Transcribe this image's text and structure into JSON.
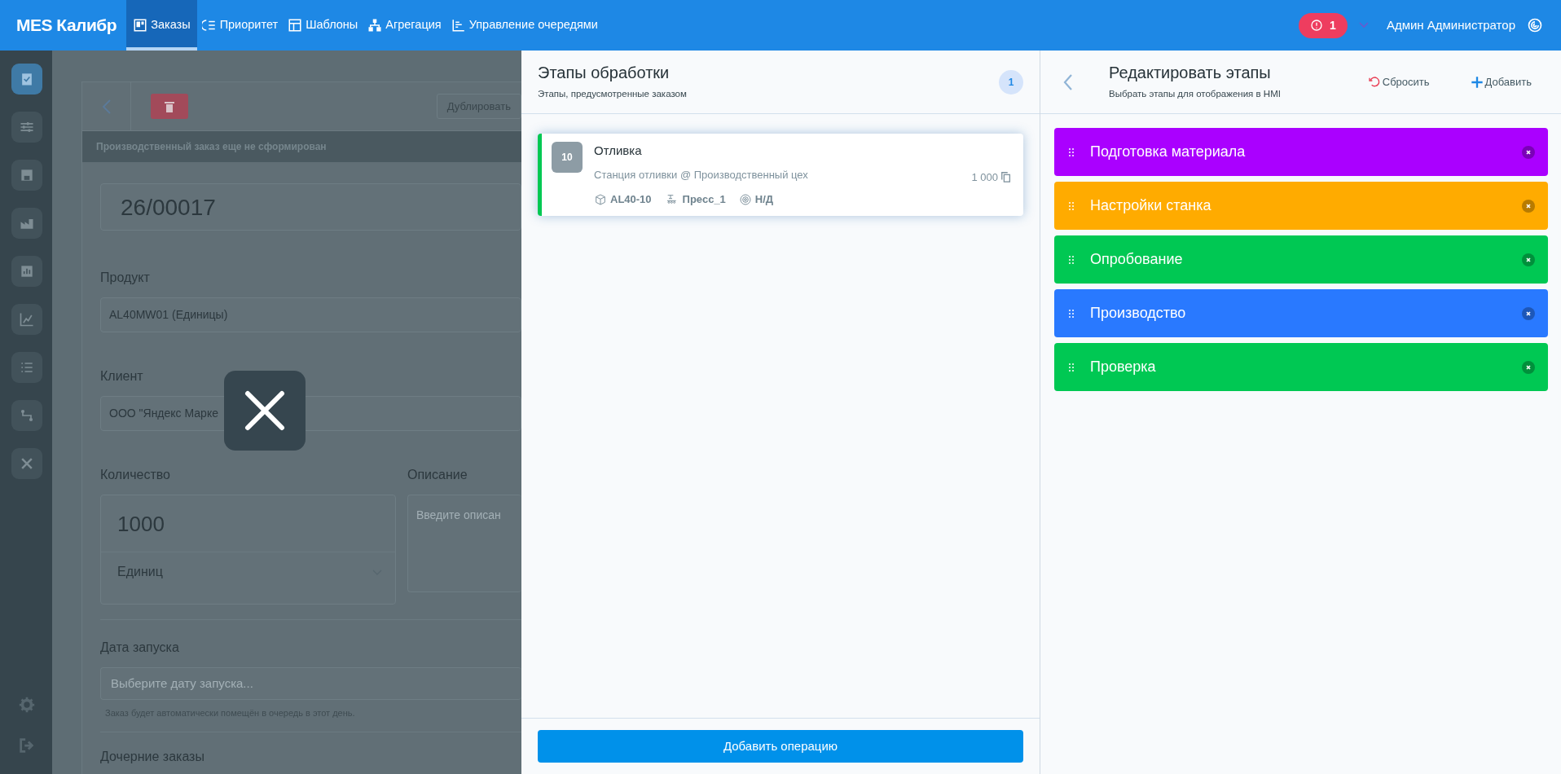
{
  "navbar": {
    "brand": "MES Калибр",
    "items": [
      {
        "label": "Заказы",
        "selected": true
      },
      {
        "label": "Приоритет",
        "selected": false
      },
      {
        "label": "Шаблоны",
        "selected": false
      },
      {
        "label": "Агрегация",
        "selected": false
      },
      {
        "label": "Управление очередями",
        "selected": false
      }
    ],
    "alert_count": "1",
    "user": "Админ Администратор"
  },
  "sidebar": {
    "items": [
      {
        "selected": true
      },
      {
        "selected": false
      },
      {
        "selected": false
      },
      {
        "selected": false
      },
      {
        "selected": false
      },
      {
        "selected": false
      },
      {
        "selected": false
      },
      {
        "selected": false
      },
      {
        "selected": false
      }
    ]
  },
  "order_form": {
    "duplicate_button": "Дублировать",
    "notice": "Производственный заказ еще не сформирован",
    "number": "26/00017",
    "product": {
      "label": "Продукт",
      "value": "AL40MW01 (Единицы)"
    },
    "client": {
      "label": "Клиент",
      "value": "ООО \"Яндекс Марке"
    },
    "quantity": {
      "label": "Количество",
      "value": "1000",
      "unit": "Единиц"
    },
    "description": {
      "label": "Описание",
      "placeholder": "Введите описан"
    },
    "start_date": {
      "label": "Дата запуска",
      "placeholder": "Выберите дату запуска...",
      "hint": "Заказ будет автоматически помещён в очередь в этот день."
    },
    "child_orders": {
      "label": "Дочерние заказы"
    }
  },
  "stages_panel": {
    "title": "Этапы обработки",
    "subtitle": "Этапы, предусмотренные заказом",
    "count": "1",
    "operations": [
      {
        "number": "10",
        "name": "Отливка",
        "location": "Станция отливки @ Производственный цех",
        "quantity": "1 000",
        "product": "AL40-10",
        "machine": "Пресс_1",
        "tool": "Н/Д"
      }
    ],
    "add_button": "Добавить операцию"
  },
  "edit_panel": {
    "title": "Редактировать этапы",
    "subtitle": "Выбрать этапы для отображения в HMI",
    "reset_button": "Сбросить",
    "add_button": "Добавить",
    "stages": [
      {
        "name": "Подготовка материала",
        "color": "#aa00ff"
      },
      {
        "name": "Настройки станка",
        "color": "#ffab00"
      },
      {
        "name": "Опробование",
        "color": "#00c853"
      },
      {
        "name": "Производство",
        "color": "#2979ff"
      },
      {
        "name": "Проверка",
        "color": "#00c853"
      }
    ]
  }
}
